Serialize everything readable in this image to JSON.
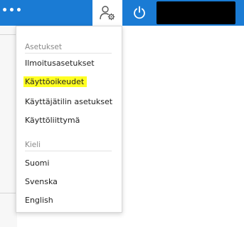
{
  "topbar": {
    "menu_glyph": "•••",
    "user_icon": "user-settings-icon",
    "power_icon": "power-icon",
    "accent_color": "#1a7bd4"
  },
  "menu": {
    "settings_header": "Asetukset",
    "items_settings": [
      "Ilmoitusasetukset",
      "Käyttöoikeudet",
      "Käyttäjätilin asetukset",
      "Käyttöliittymä"
    ],
    "highlighted_item": "Käyttöoikeudet",
    "highlight_color": "#ffff22",
    "language_header": "Kieli",
    "items_language": [
      "Suomi",
      "Svenska",
      "English"
    ]
  }
}
